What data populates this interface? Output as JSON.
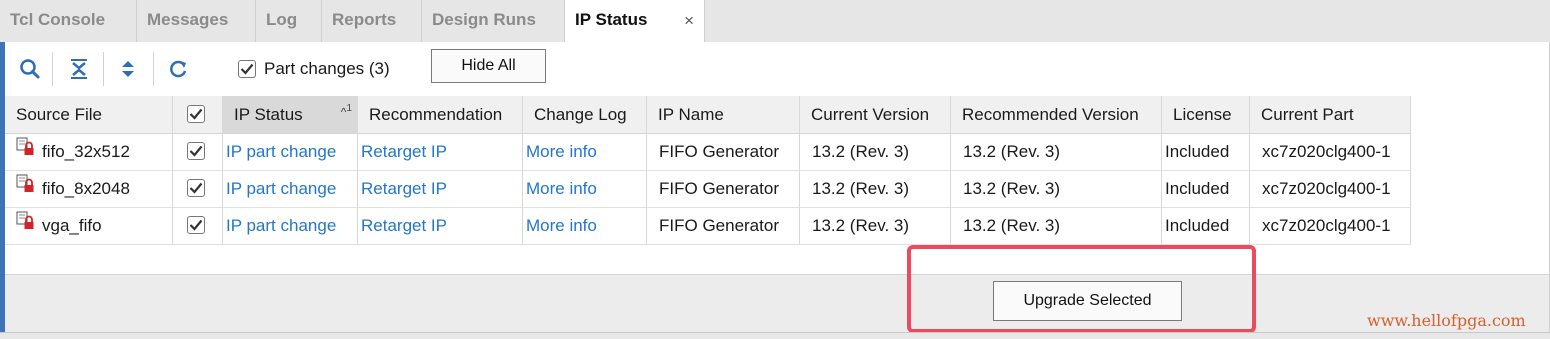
{
  "tabs": [
    {
      "label": "Tcl Console",
      "active": false
    },
    {
      "label": "Messages",
      "active": false
    },
    {
      "label": "Log",
      "active": false
    },
    {
      "label": "Reports",
      "active": false
    },
    {
      "label": "Design Runs",
      "active": false
    },
    {
      "label": "IP Status",
      "active": true,
      "close": "×"
    }
  ],
  "toolbar": {
    "icons": [
      "search-icon",
      "collapse-all-icon",
      "expand-all-icon",
      "refresh-icon"
    ],
    "part_changes": {
      "checked": true,
      "label": "Part changes (3)"
    },
    "hide_all_label": "Hide All"
  },
  "table": {
    "columns": [
      "Source File",
      "",
      "IP Status",
      "Recommendation",
      "Change Log",
      "IP Name",
      "Current Version",
      "Recommended Version",
      "License",
      "Current Part"
    ],
    "sort": {
      "column": "IP Status",
      "indicator": "^",
      "order": "1"
    },
    "rows": [
      {
        "source": "fifo_32x512",
        "checked": true,
        "ip_status": "IP part change",
        "recommendation": "Retarget IP",
        "change_log": "More info",
        "ip_name": "FIFO Generator",
        "current_version": "13.2 (Rev. 3)",
        "recommended_version": "13.2 (Rev. 3)",
        "license": "Included",
        "current_part": "xc7z020clg400-1"
      },
      {
        "source": "fifo_8x2048",
        "checked": true,
        "ip_status": "IP part change",
        "recommendation": "Retarget IP",
        "change_log": "More info",
        "ip_name": "FIFO Generator",
        "current_version": "13.2 (Rev. 3)",
        "recommended_version": "13.2 (Rev. 3)",
        "license": "Included",
        "current_part": "xc7z020clg400-1"
      },
      {
        "source": "vga_fifo",
        "checked": true,
        "ip_status": "IP part change",
        "recommendation": "Retarget IP",
        "change_log": "More info",
        "ip_name": "FIFO Generator",
        "current_version": "13.2 (Rev. 3)",
        "recommended_version": "13.2 (Rev. 3)",
        "license": "Included",
        "current_part": "xc7z020clg400-1"
      }
    ]
  },
  "footer": {
    "upgrade_label": "Upgrade Selected"
  },
  "watermark": "www.hellofpga.com",
  "colors": {
    "accent": "#3f73b8",
    "link": "#2277cc",
    "highlight": "#ec4a5e",
    "lock_icon": "#d2232a"
  }
}
